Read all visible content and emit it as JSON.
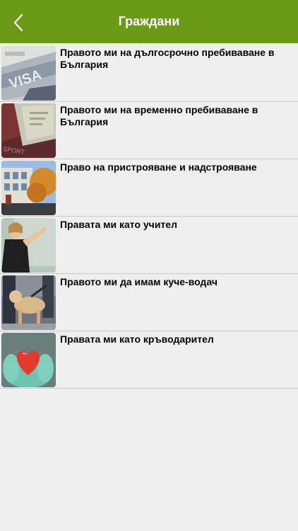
{
  "nav": {
    "title": "Граждани",
    "back_icon": "chevron-left-icon"
  },
  "colors": {
    "navbar": "#6b9a17",
    "background": "#efefef",
    "separator": "#c9c9c9"
  },
  "items": [
    {
      "label": "Правото ми на дългосрочно пребиваване в България",
      "image": "visa-stamp-photo"
    },
    {
      "label": "Правото ми на временно пребиваване в България",
      "image": "passport-photo"
    },
    {
      "label": "Право на пристрояване и надстрояване",
      "image": "building-photo"
    },
    {
      "label": "Правата ми като учител",
      "image": "teacher-photo"
    },
    {
      "label": "Правото ми да имам куче-водач",
      "image": "guide-dog-photo"
    },
    {
      "label": "Правата ми като кръводарител",
      "image": "heart-hands-photo"
    }
  ]
}
